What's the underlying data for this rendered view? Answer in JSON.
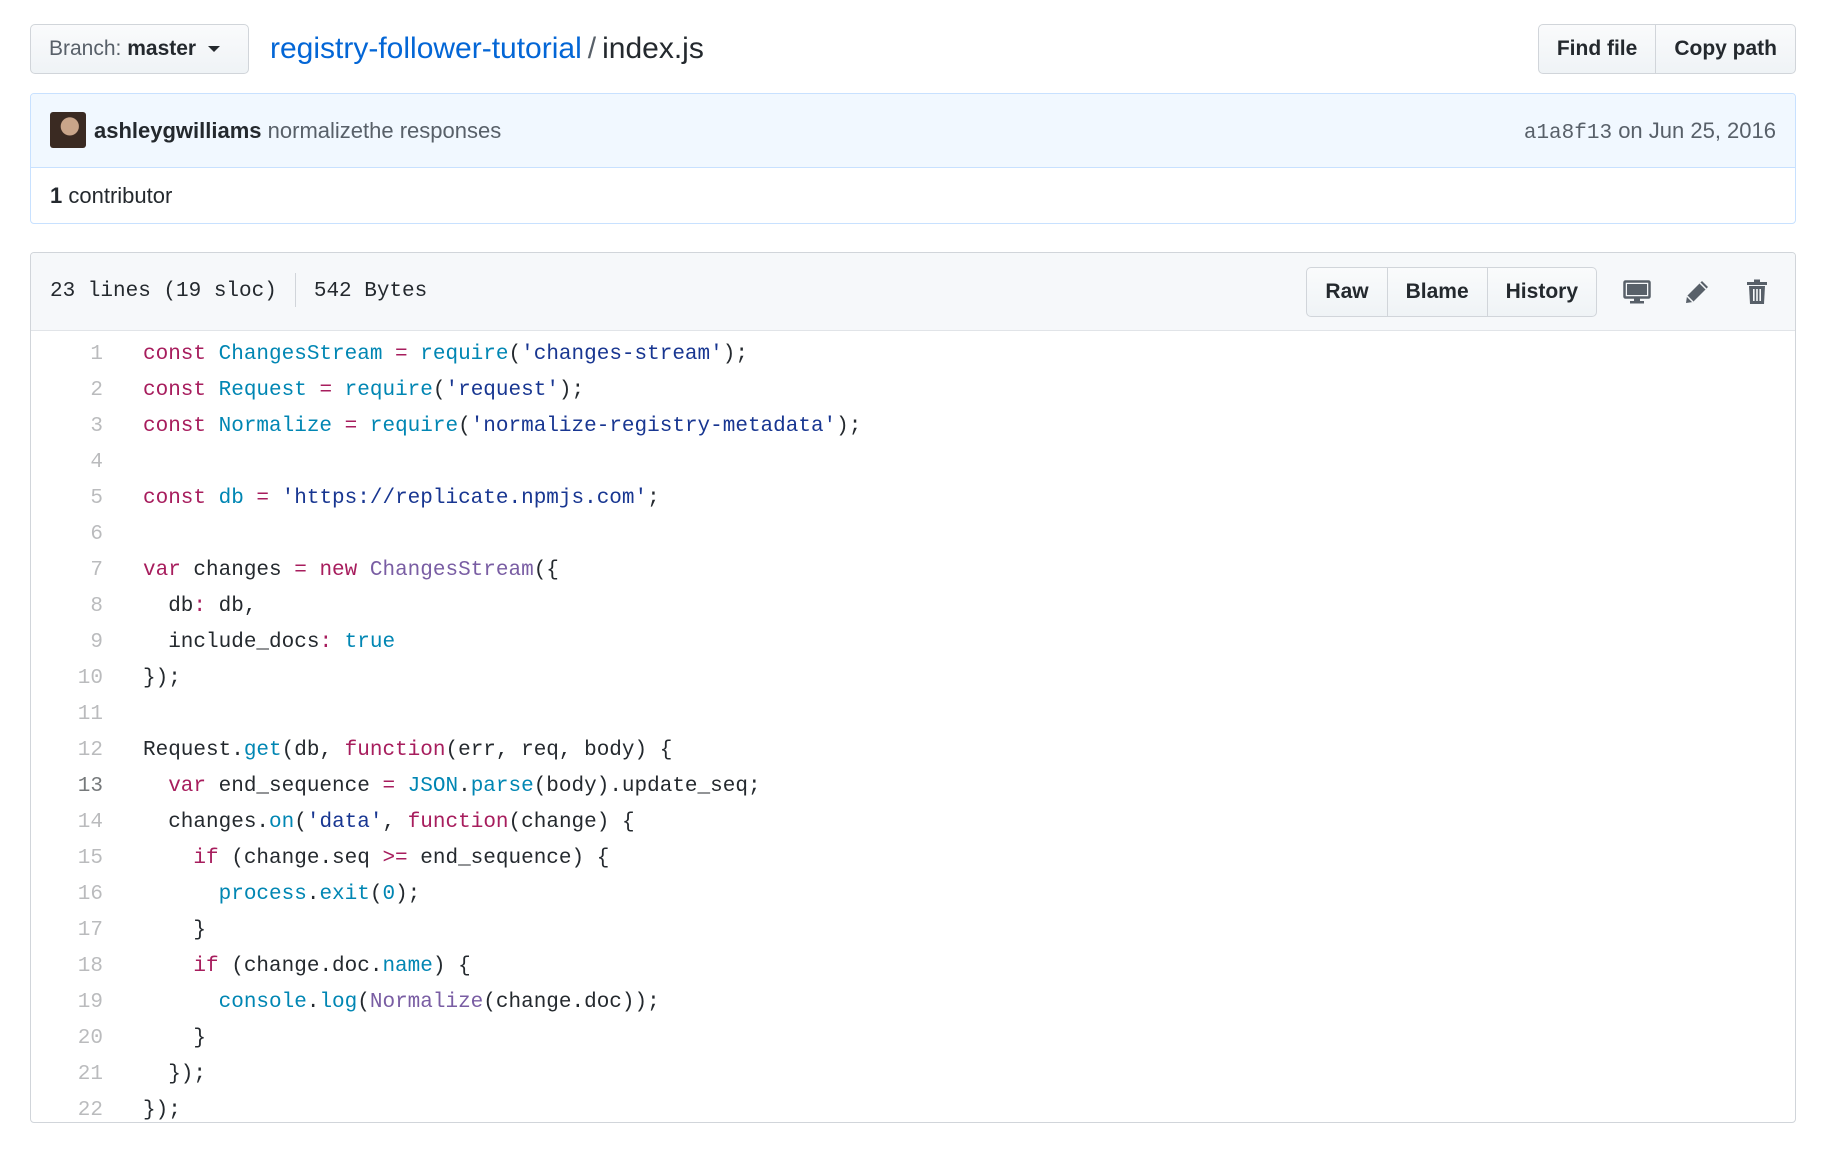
{
  "branch": {
    "prefix": "Branch:",
    "name": "master"
  },
  "breadcrumb": {
    "repo": "registry-follower-tutorial",
    "separator": "/",
    "file": "index.js"
  },
  "top_buttons": {
    "find_file": "Find file",
    "copy_path": "Copy path"
  },
  "commit": {
    "author": "ashleygwilliams",
    "message": "normalizethe responses",
    "sha": "a1a8f13",
    "date": "on Jun 25, 2016"
  },
  "contributors": {
    "count": "1",
    "label": "contributor"
  },
  "file_info": {
    "lines": "23 lines (19 sloc)",
    "size": "542 Bytes"
  },
  "file_actions": {
    "raw": "Raw",
    "blame": "Blame",
    "history": "History"
  },
  "icons": [
    "desktop-icon",
    "pencil-icon",
    "trash-icon"
  ],
  "colors": {
    "link": "#0366d6",
    "keyword": "#a71d5d",
    "constant": "#0086b3",
    "string": "#183691",
    "entity": "#795da3",
    "commit_bg": "#f1f8ff"
  },
  "code": {
    "active_line": 13,
    "lines": [
      [
        [
          "k",
          "const"
        ],
        [
          "",
          ""
        ],
        [
          "c1",
          " ChangesStream"
        ],
        [
          "k",
          " ="
        ],
        [
          "c1",
          " require"
        ],
        [
          "",
          "("
        ],
        [
          "s",
          "'changes-stream'"
        ],
        [
          "",
          ");"
        ]
      ],
      [
        [
          "k",
          "const"
        ],
        [
          "c1",
          " Request"
        ],
        [
          "k",
          " ="
        ],
        [
          "c1",
          " require"
        ],
        [
          "",
          "("
        ],
        [
          "s",
          "'request'"
        ],
        [
          "",
          ");"
        ]
      ],
      [
        [
          "k",
          "const"
        ],
        [
          "c1",
          " Normalize"
        ],
        [
          "k",
          " ="
        ],
        [
          "c1",
          " require"
        ],
        [
          "",
          "("
        ],
        [
          "s",
          "'normalize-registry-metadata'"
        ],
        [
          "",
          ");"
        ]
      ],
      [],
      [
        [
          "k",
          "const"
        ],
        [
          "c1",
          " db"
        ],
        [
          "k",
          " ="
        ],
        [
          "s",
          " 'https://replicate.npmjs.com'"
        ],
        [
          "",
          ";"
        ]
      ],
      [],
      [
        [
          "k",
          "var"
        ],
        [
          "",
          " changes "
        ],
        [
          "k",
          "="
        ],
        [
          "k",
          " new"
        ],
        [
          "f",
          " ChangesStream"
        ],
        [
          "",
          "({"
        ]
      ],
      [
        [
          "",
          "  db"
        ],
        [
          "k",
          ":"
        ],
        [
          "",
          " db,"
        ]
      ],
      [
        [
          "",
          "  include_docs"
        ],
        [
          "k",
          ":"
        ],
        [
          "c1",
          " true"
        ]
      ],
      [
        [
          "",
          "});"
        ]
      ],
      [],
      [
        [
          "",
          "Request."
        ],
        [
          "c1",
          "get"
        ],
        [
          "",
          "(db, "
        ],
        [
          "k",
          "function"
        ],
        [
          "",
          "(err, req, body) {"
        ]
      ],
      [
        [
          "k",
          "  var"
        ],
        [
          "",
          " end_sequence "
        ],
        [
          "k",
          "="
        ],
        [
          "c1",
          " JSON"
        ],
        [
          "",
          "."
        ],
        [
          "c1",
          "parse"
        ],
        [
          "",
          "(body).update_seq;"
        ]
      ],
      [
        [
          "",
          "  changes."
        ],
        [
          "c1",
          "on"
        ],
        [
          "",
          "("
        ],
        [
          "s",
          "'data'"
        ],
        [
          "",
          ", "
        ],
        [
          "k",
          "function"
        ],
        [
          "",
          "(change) {"
        ]
      ],
      [
        [
          "k",
          "    if"
        ],
        [
          "",
          " (change.seq "
        ],
        [
          "k",
          ">="
        ],
        [
          "",
          " end_sequence) {"
        ]
      ],
      [
        [
          "c1",
          "      process"
        ],
        [
          "",
          "."
        ],
        [
          "c1",
          "exit"
        ],
        [
          "",
          "("
        ],
        [
          "c1",
          "0"
        ],
        [
          "",
          ");"
        ]
      ],
      [
        [
          "",
          "    }"
        ]
      ],
      [
        [
          "k",
          "    if"
        ],
        [
          "",
          " (change.doc."
        ],
        [
          "c1",
          "name"
        ],
        [
          "",
          ") {"
        ]
      ],
      [
        [
          "c1",
          "      console"
        ],
        [
          "",
          "."
        ],
        [
          "c1",
          "log"
        ],
        [
          "",
          "("
        ],
        [
          "f",
          "Normalize"
        ],
        [
          "",
          "(change.doc));"
        ]
      ],
      [
        [
          "",
          "    }"
        ]
      ],
      [
        [
          "",
          "  });"
        ]
      ],
      [
        [
          "",
          "});"
        ]
      ]
    ]
  }
}
